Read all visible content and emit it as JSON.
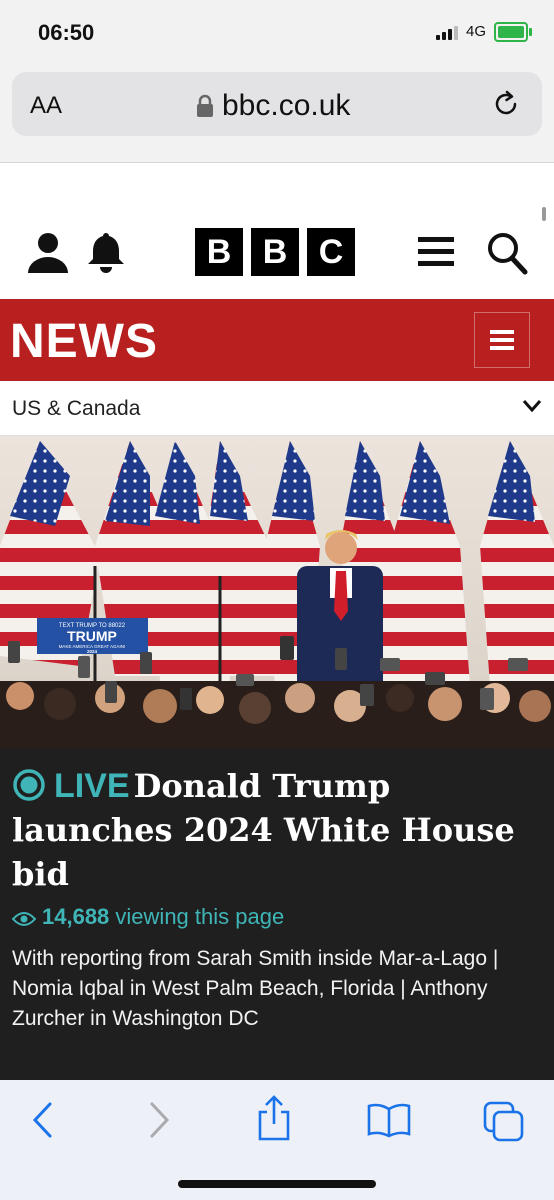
{
  "status_bar": {
    "time": "06:50",
    "network": "4G"
  },
  "browser": {
    "text_size_label": "AA",
    "url": "bbc.co.uk"
  },
  "site_header": {
    "logo_letters": [
      "B",
      "B",
      "C"
    ]
  },
  "news_banner": {
    "title": "NEWS"
  },
  "section_nav": {
    "label": "US & Canada"
  },
  "hero": {
    "sign_top": "TEXT TRUMP TO 88022",
    "sign_name": "TRUMP",
    "sign_slogan": "MAKE AMERICA GREAT AGAIN!",
    "sign_year": "2024"
  },
  "article": {
    "live_label": "LIVE",
    "headline": "Donald Trump launches 2024 White House bid",
    "viewer_count": "14,688",
    "viewer_suffix": "viewing this page",
    "summary": "With reporting from Sarah Smith inside Mar-a-Lago | Nomia Iqbal in West Palm Beach, Florida | Anthony Zurcher in Washington DC"
  },
  "colors": {
    "bbc_red": "#b8201f",
    "live_teal": "#3fb5b8",
    "ios_blue": "#1a73e8"
  }
}
